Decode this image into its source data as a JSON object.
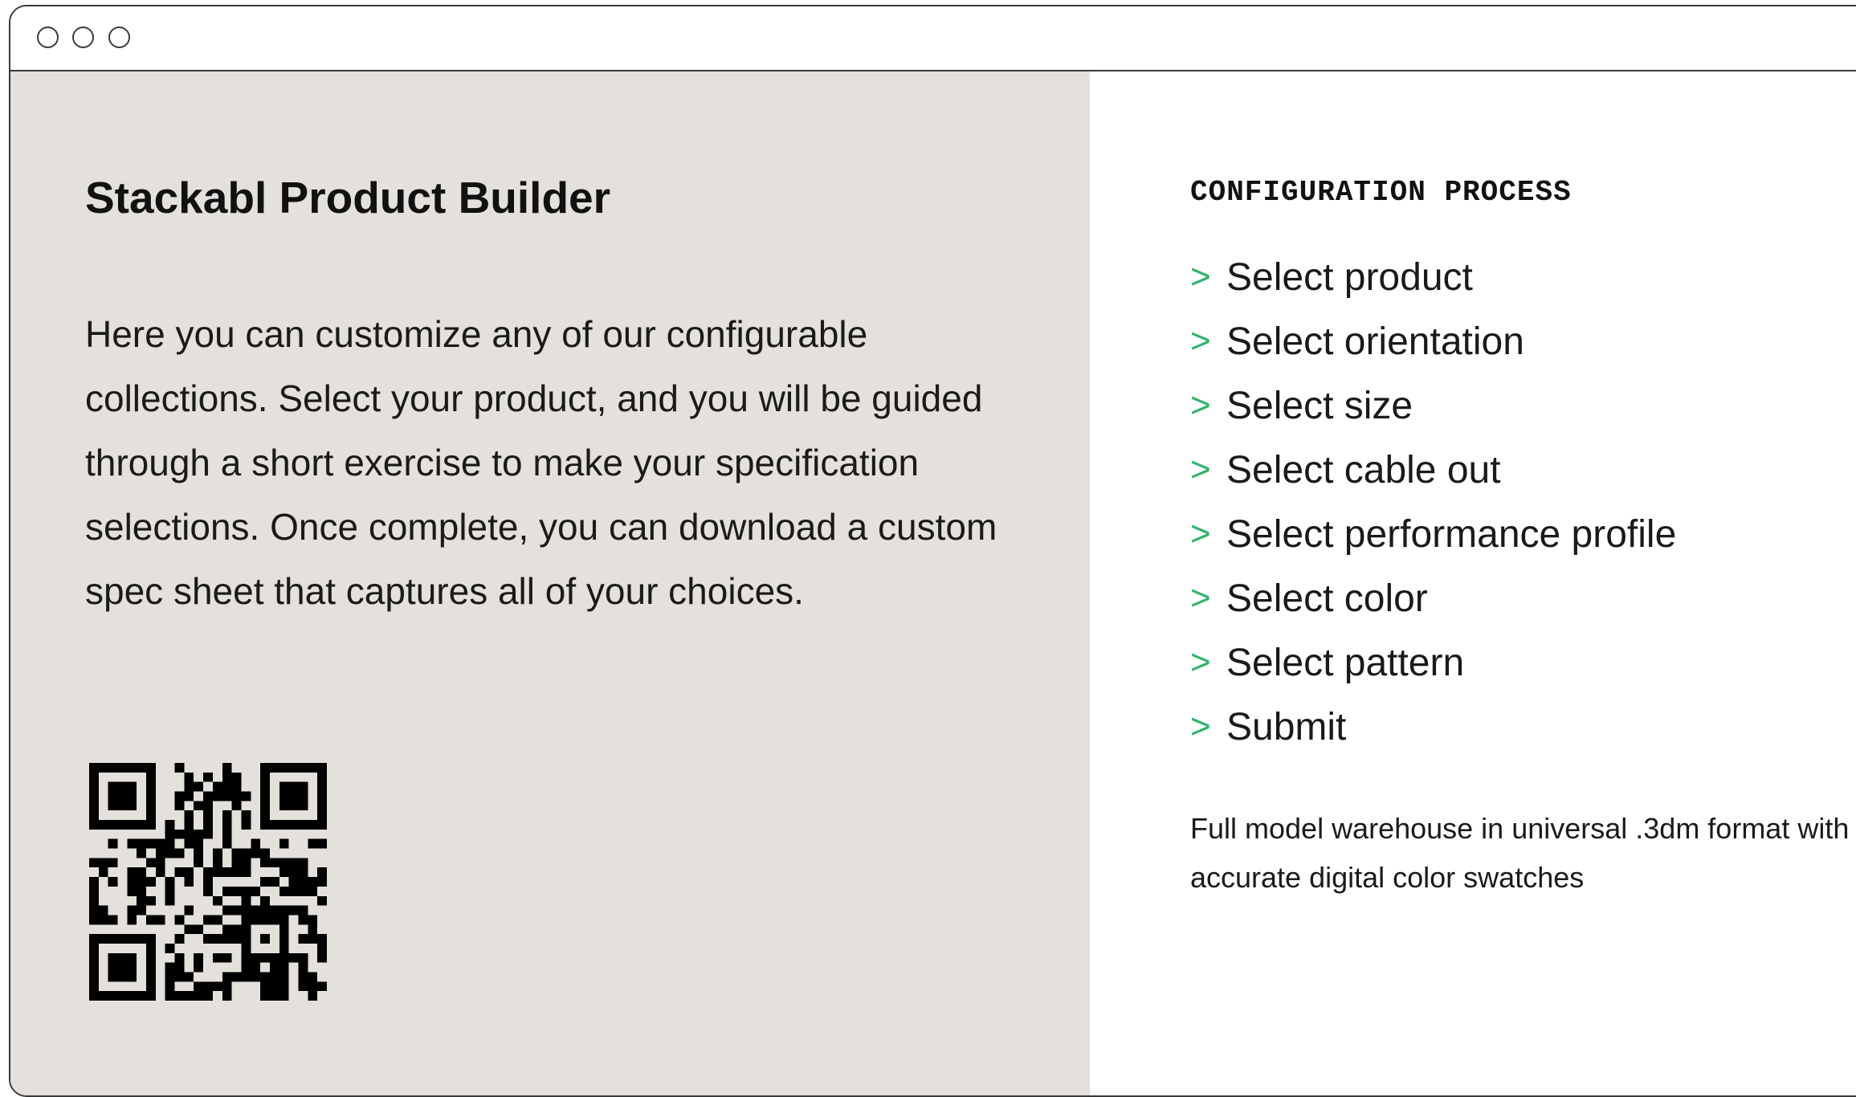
{
  "left": {
    "title": "Stackabl Product Builder",
    "intro": "Here you can customize any of our configurable collections. Select your product, and you will be guided through a short exercise to make your specification selections. Once complete, you can download a custom spec sheet that captures all of your choices."
  },
  "right": {
    "section_label": "CONFIGURATION PROCESS",
    "chevron": ">",
    "steps": [
      "Select product",
      "Select orientation",
      "Select size",
      "Select cable out",
      "Select performance profile",
      "Select color",
      "Select pattern",
      "Submit"
    ],
    "note": "Full model warehouse in universal .3dm format with accurate digital color swatches"
  },
  "colors": {
    "left_panel_bg": "#e4e0db",
    "accent_chevron": "#2db36b",
    "text": "#1a1a1a"
  }
}
